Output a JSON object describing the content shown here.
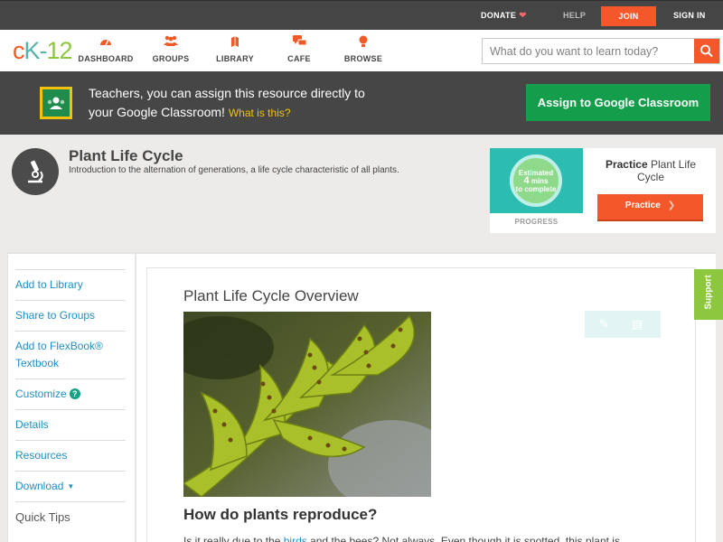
{
  "topbar": {
    "donate": "DONATE",
    "help": "HELP",
    "join": "JOIN",
    "sign_in": "SIGN IN"
  },
  "logo": {
    "c": "c",
    "k": "K",
    "dash": "-",
    "num": "12"
  },
  "nav": [
    {
      "label": "DASHBOARD",
      "icon": "dashboard-icon"
    },
    {
      "label": "GROUPS",
      "icon": "groups-icon"
    },
    {
      "label": "LIBRARY",
      "icon": "library-icon"
    },
    {
      "label": "CAFE",
      "icon": "cafe-icon"
    },
    {
      "label": "BROWSE",
      "icon": "browse-icon"
    }
  ],
  "search": {
    "placeholder": "What do you want to learn today?"
  },
  "classroom": {
    "line1": "Teachers, you can assign this resource directly to",
    "line2": "your Google Classroom!",
    "what": "What is this?",
    "button": "Assign to Google Classroom"
  },
  "concept": {
    "title": "Plant Life Cycle",
    "description": "Introduction to the alternation of generations, a life cycle characteristic of all plants."
  },
  "practice": {
    "estimated": "Estimated",
    "mins": "4",
    "mins_label": "mins",
    "to_complete": "to complete",
    "progress_label": "PROGRESS",
    "title_bold": "Practice",
    "title_rest": "Plant Life Cycle",
    "button": "Practice"
  },
  "sidebar": {
    "items": [
      {
        "label": "Add to Library"
      },
      {
        "label": "Share to Groups"
      },
      {
        "label": "Add to FlexBook® Textbook"
      },
      {
        "label": "Customize"
      },
      {
        "label": "Details"
      },
      {
        "label": "Resources"
      },
      {
        "label": "Download"
      },
      {
        "label": "Quick Tips"
      }
    ]
  },
  "main": {
    "overview_title": "Plant Life Cycle Overview",
    "question": "How do plants reproduce?",
    "para_start": "Is it really due to the ",
    "para_link": "birds",
    "para_end": " and the bees? Not always. Even though it is spotted, this plant is"
  },
  "support": {
    "label": "Support"
  },
  "colors": {
    "accent": "#f4582a",
    "brand_teal": "#56b3a9",
    "brand_green": "#8dc63f",
    "link": "#1f8ec3",
    "classroom_green": "#149e4b"
  }
}
